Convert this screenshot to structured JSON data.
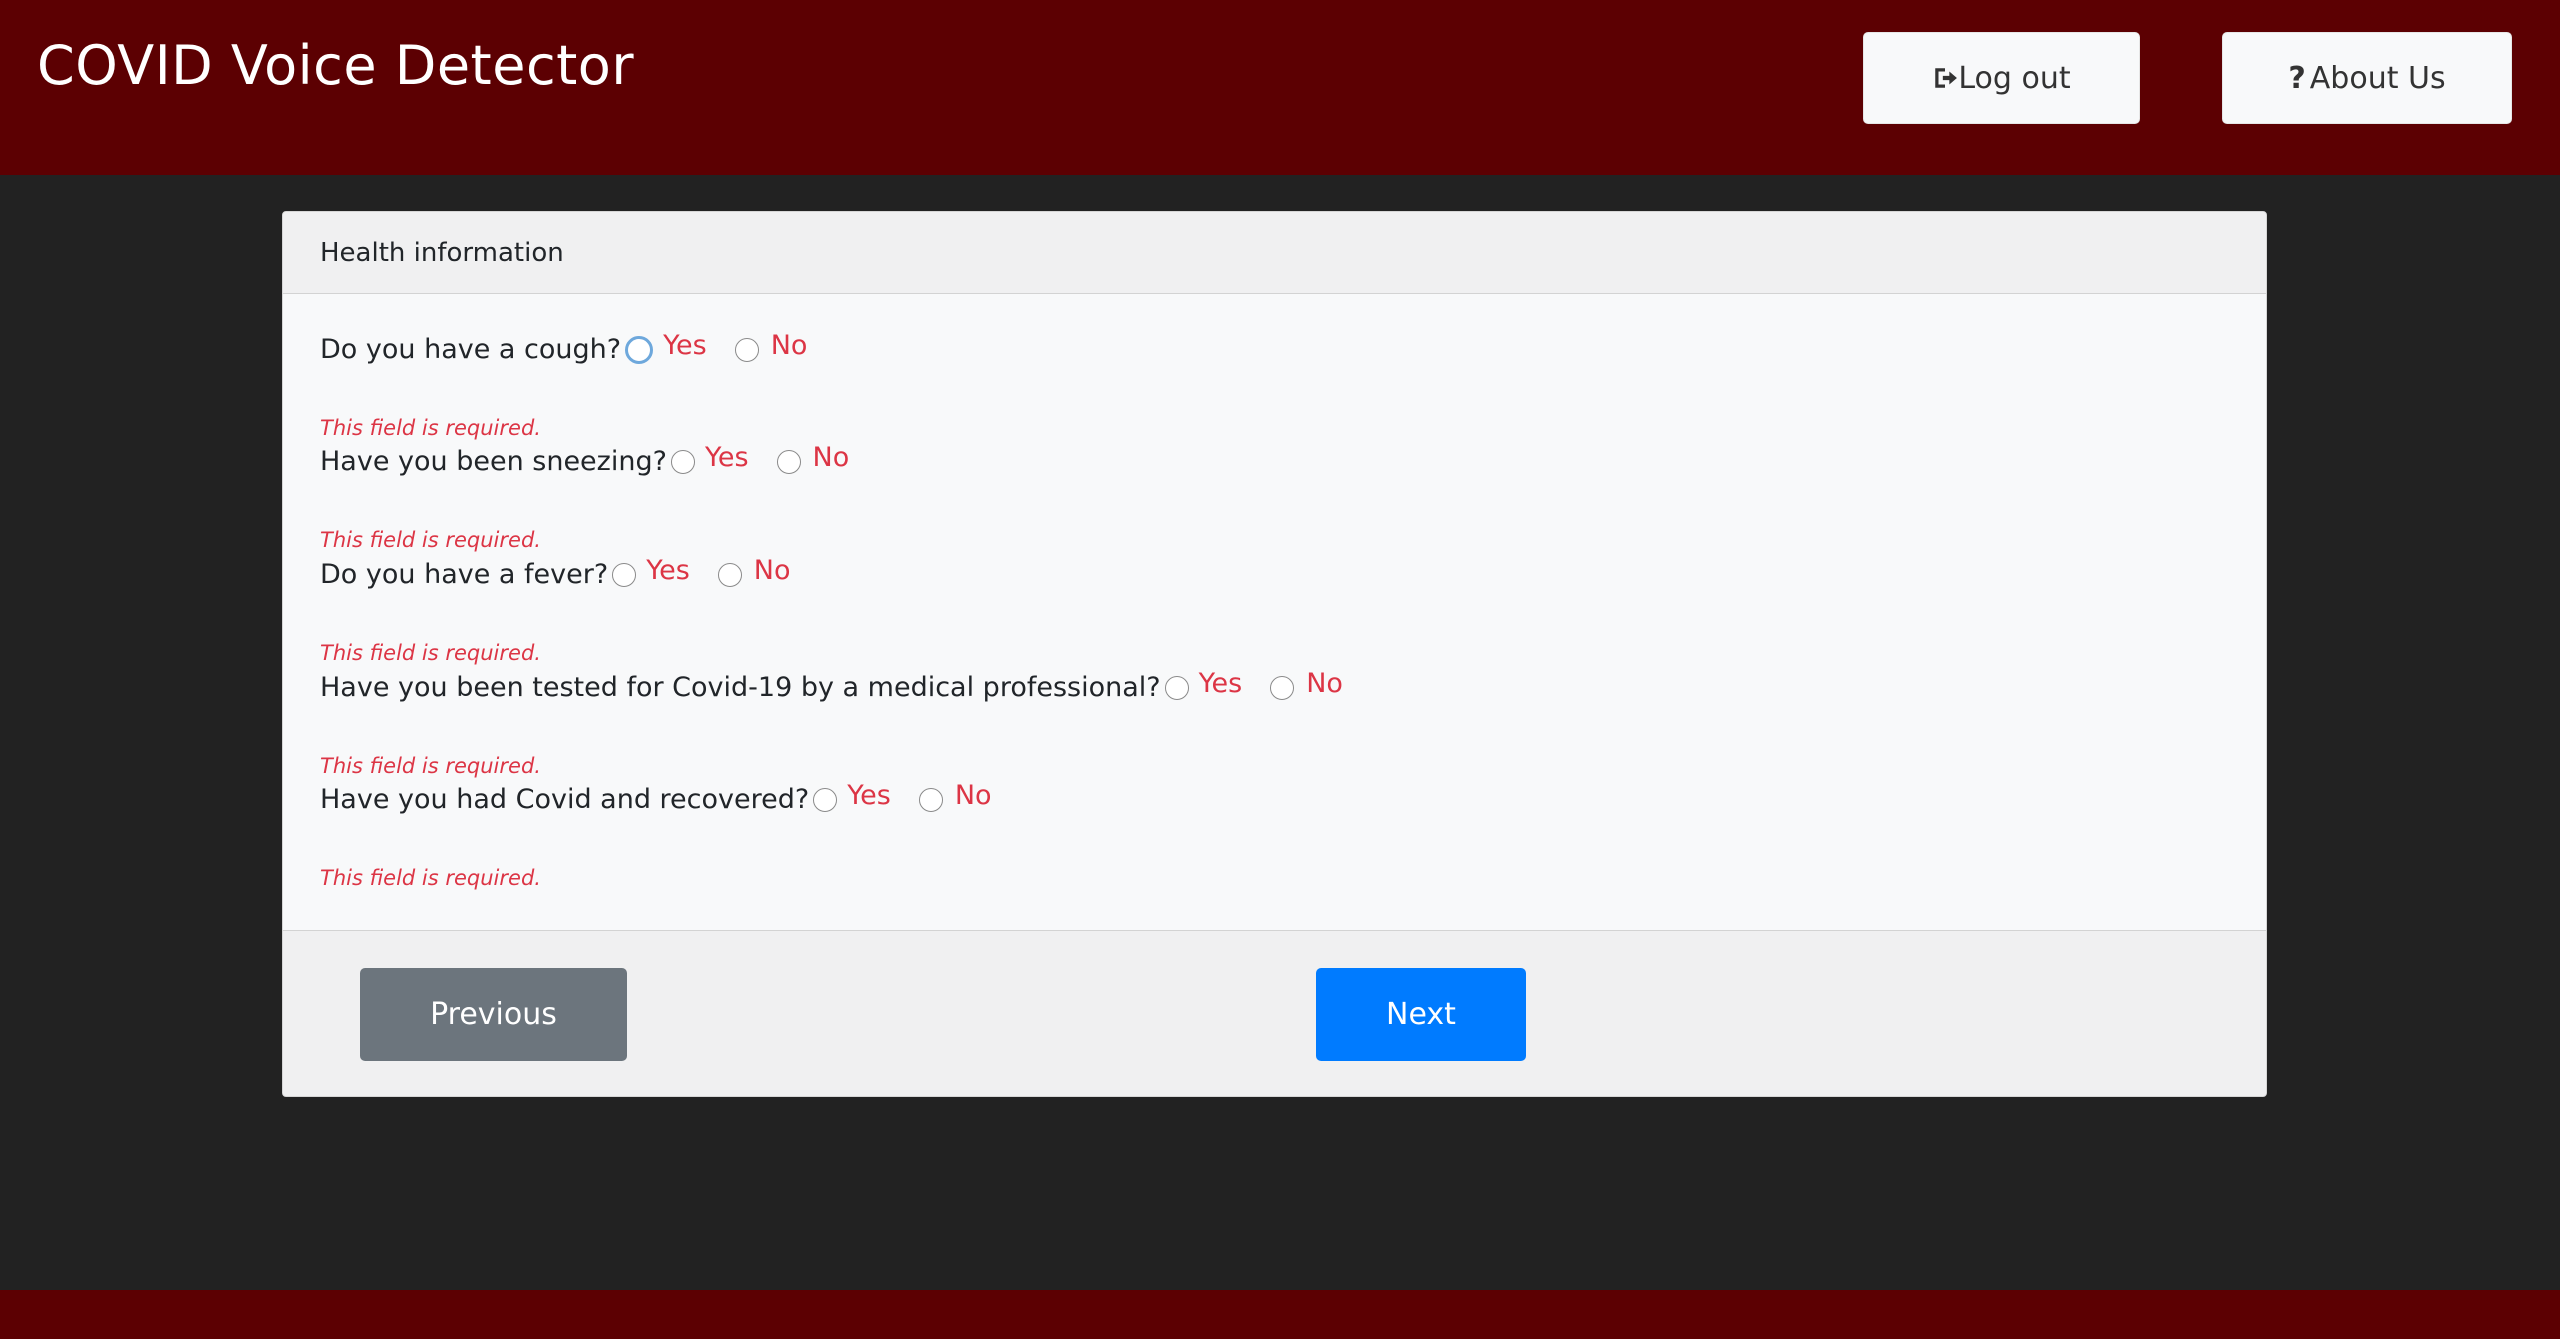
{
  "header": {
    "title": "COVID Voice Detector",
    "logout_label": "Log out",
    "about_icon": "?",
    "about_label": "About Us"
  },
  "card": {
    "title": "Health information",
    "questions": [
      {
        "text": "Do you have a cough?",
        "yes": "Yes",
        "no": "No",
        "error": "This field is required."
      },
      {
        "text": "Have you been sneezing?",
        "yes": "Yes",
        "no": "No",
        "error": "This field is required."
      },
      {
        "text": "Do you have a fever?",
        "yes": "Yes",
        "no": "No",
        "error": "This field is required."
      },
      {
        "text": "Have you been tested for Covid-19 by a medical professional?",
        "yes": "Yes",
        "no": "No",
        "error": "This field is required."
      },
      {
        "text": "Have you had Covid and recovered?",
        "yes": "Yes",
        "no": "No",
        "error": "This field is required."
      }
    ]
  },
  "footer": {
    "previous_label": "Previous",
    "next_label": "Next"
  },
  "colors": {
    "brand": "#5c0002",
    "error": "#dc3545",
    "primary": "#007bff",
    "secondary": "#6c757d"
  },
  "icons": {
    "logout": "sign-out-icon",
    "about": "question-icon"
  }
}
